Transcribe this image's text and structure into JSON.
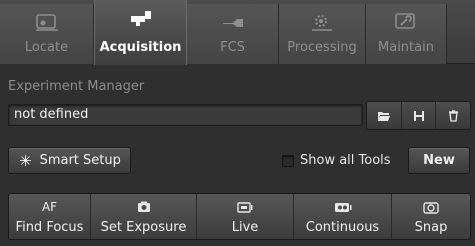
{
  "tabs": [
    {
      "label": "Locate",
      "icon": "locate-icon",
      "active": false
    },
    {
      "label": "Acquisition",
      "icon": "acquisition-icon",
      "active": true
    },
    {
      "label": "FCS",
      "icon": "fcs-icon",
      "active": false
    },
    {
      "label": "Processing",
      "icon": "processing-icon",
      "active": false
    },
    {
      "label": "Maintain",
      "icon": "maintain-icon",
      "active": false
    }
  ],
  "experiment_manager": {
    "title": "Experiment Manager",
    "value": "not defined",
    "icons": [
      "folder-open-icon",
      "save-icon",
      "delete-icon"
    ]
  },
  "smart_setup": {
    "label": "Smart Setup",
    "icon": "star-icon"
  },
  "show_all_tools": {
    "label": "Show all Tools",
    "checked": false
  },
  "new_button": {
    "label": "New"
  },
  "actions": [
    {
      "label": "Find Focus",
      "icon_text": "AF",
      "icon": "autofocus-icon"
    },
    {
      "label": "Set Exposure",
      "icon": "camera-icon"
    },
    {
      "label": "Live",
      "icon": "live-icon"
    },
    {
      "label": "Continuous",
      "icon": "continuous-icon"
    },
    {
      "label": "Snap",
      "icon": "snap-icon"
    }
  ],
  "colors": {
    "background": "#2f2f2f",
    "text": "#e6e6e6",
    "inactive_tab_text": "#8e8e8e"
  }
}
